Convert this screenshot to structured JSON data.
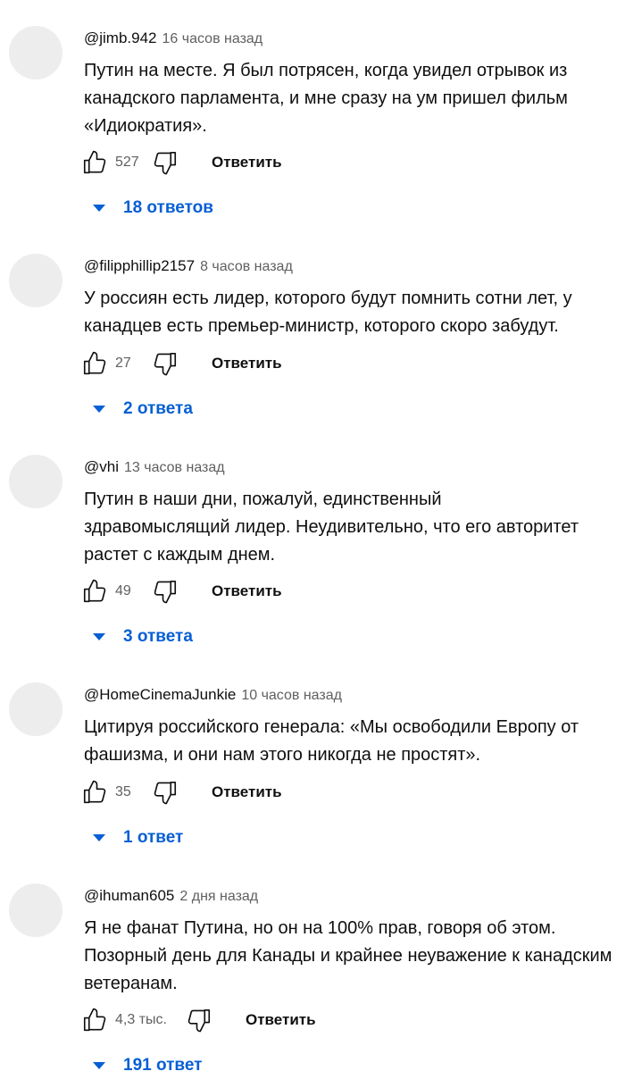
{
  "comments": [
    {
      "author": "@jimb.942",
      "time": "16 часов назад",
      "text": "Путин на месте. Я был потрясен, когда увидел отрывок из канадского парламента, и мне сразу на ум пришел фильм «Идиократия».",
      "likes": "527",
      "reply_label": "Ответить",
      "replies_label": "18 ответов"
    },
    {
      "author": "@filipphillip2157",
      "time": "8 часов назад",
      "text": "У россиян есть лидер, которого будут помнить сотни лет, у канадцев есть премьер-министр, которого скоро забудут.",
      "likes": "27",
      "reply_label": "Ответить",
      "replies_label": "2 ответа"
    },
    {
      "author": "@vhi",
      "time": "13 часов назад",
      "text": "Путин в наши дни, пожалуй, единственный здравомыслящий лидер. Неудивительно, что его авторитет растет с каждым днем.",
      "likes": "49",
      "reply_label": "Ответить",
      "replies_label": "3 ответа"
    },
    {
      "author": "@HomeCinemaJunkie",
      "time": "10 часов назад",
      "text": "Цитируя российского генерала: «Мы освободили Европу от фашизма, и они нам этого никогда не простят».",
      "likes": "35",
      "reply_label": "Ответить",
      "replies_label": "1 ответ"
    },
    {
      "author": "@ihuman605",
      "time": "2 дня назад",
      "text": "Я не фанат Путина, но он на 100% прав, говоря об этом. Позорный день для Канады и крайнее неуважение к канадским ветеранам.",
      "likes": "4,3 тыс.",
      "reply_label": "Ответить",
      "replies_label": "191 ответ"
    }
  ],
  "icons": {
    "like": "thumbs-up-icon",
    "dislike": "thumbs-down-icon",
    "expand": "caret-down-icon"
  },
  "colors": {
    "link": "#065fd4",
    "secondary_text": "#606060",
    "avatar_placeholder": "#ededed"
  }
}
